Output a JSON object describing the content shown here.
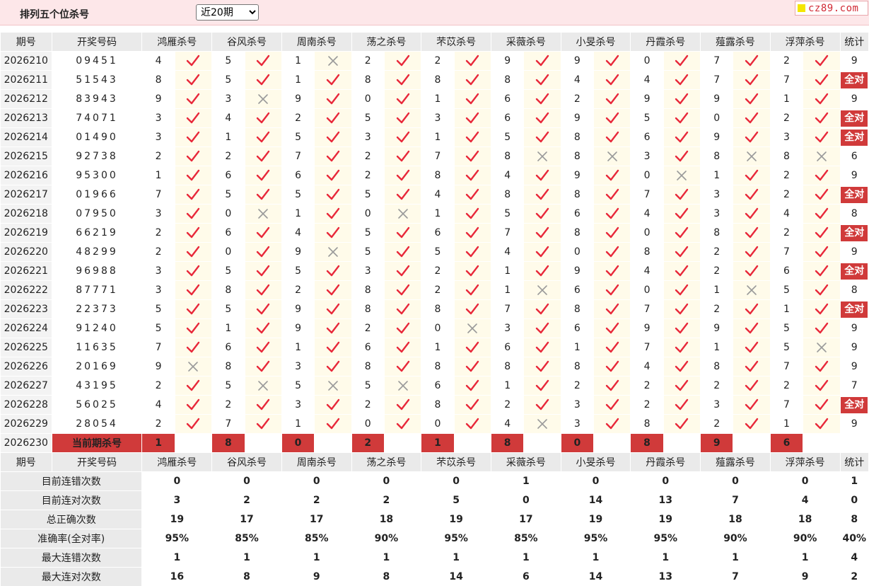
{
  "header": {
    "title": "排列五个位杀号",
    "period_select": {
      "selected": "近20期",
      "options": [
        "近20期"
      ]
    },
    "brand": "cz89.com"
  },
  "columns": {
    "issue": "期号",
    "draw": "开奖号码",
    "experts": [
      "鸿雁杀号",
      "谷风杀号",
      "周南杀号",
      "荡之杀号",
      "芣苡杀号",
      "采薇杀号",
      "小旻杀号",
      "丹霞杀号",
      "薤露杀号",
      "浮萍杀号"
    ],
    "stat": "统计"
  },
  "all_right_label": "全对",
  "rows": [
    {
      "issue": "2026210",
      "draw": "09451",
      "kills": [
        4,
        5,
        1,
        2,
        2,
        9,
        9,
        0,
        7,
        2
      ],
      "ok": [
        1,
        1,
        0,
        1,
        1,
        1,
        1,
        1,
        1,
        1
      ],
      "stat": "9"
    },
    {
      "issue": "2026211",
      "draw": "51543",
      "kills": [
        8,
        5,
        1,
        8,
        8,
        8,
        4,
        4,
        7,
        7
      ],
      "ok": [
        1,
        1,
        1,
        1,
        1,
        1,
        1,
        1,
        1,
        1
      ],
      "stat": "全对"
    },
    {
      "issue": "2026212",
      "draw": "83943",
      "kills": [
        9,
        3,
        9,
        0,
        1,
        6,
        2,
        9,
        9,
        1
      ],
      "ok": [
        1,
        0,
        1,
        1,
        1,
        1,
        1,
        1,
        1,
        1
      ],
      "stat": "9"
    },
    {
      "issue": "2026213",
      "draw": "74071",
      "kills": [
        3,
        4,
        2,
        5,
        3,
        6,
        9,
        5,
        0,
        2
      ],
      "ok": [
        1,
        1,
        1,
        1,
        1,
        1,
        1,
        1,
        1,
        1
      ],
      "stat": "全对"
    },
    {
      "issue": "2026214",
      "draw": "01490",
      "kills": [
        3,
        1,
        5,
        3,
        1,
        5,
        8,
        6,
        9,
        3
      ],
      "ok": [
        1,
        1,
        1,
        1,
        1,
        1,
        1,
        1,
        1,
        1
      ],
      "stat": "全对"
    },
    {
      "issue": "2026215",
      "draw": "92738",
      "kills": [
        2,
        2,
        7,
        2,
        7,
        8,
        8,
        3,
        8,
        8
      ],
      "ok": [
        1,
        1,
        1,
        1,
        1,
        0,
        0,
        1,
        0,
        0
      ],
      "stat": "6"
    },
    {
      "issue": "2026216",
      "draw": "95300",
      "kills": [
        1,
        6,
        6,
        2,
        8,
        4,
        9,
        0,
        1,
        2
      ],
      "ok": [
        1,
        1,
        1,
        1,
        1,
        1,
        1,
        0,
        1,
        1
      ],
      "stat": "9"
    },
    {
      "issue": "2026217",
      "draw": "01966",
      "kills": [
        7,
        5,
        5,
        5,
        4,
        8,
        8,
        7,
        3,
        2
      ],
      "ok": [
        1,
        1,
        1,
        1,
        1,
        1,
        1,
        1,
        1,
        1
      ],
      "stat": "全对"
    },
    {
      "issue": "2026218",
      "draw": "07950",
      "kills": [
        3,
        0,
        1,
        0,
        1,
        5,
        6,
        4,
        3,
        4
      ],
      "ok": [
        1,
        0,
        1,
        0,
        1,
        1,
        1,
        1,
        1,
        1
      ],
      "stat": "8"
    },
    {
      "issue": "2026219",
      "draw": "66219",
      "kills": [
        2,
        6,
        4,
        5,
        6,
        7,
        8,
        0,
        8,
        2
      ],
      "ok": [
        1,
        1,
        1,
        1,
        1,
        1,
        1,
        1,
        1,
        1
      ],
      "stat": "全对"
    },
    {
      "issue": "2026220",
      "draw": "48299",
      "kills": [
        2,
        0,
        9,
        5,
        5,
        4,
        0,
        8,
        2,
        7
      ],
      "ok": [
        1,
        1,
        0,
        1,
        1,
        1,
        1,
        1,
        1,
        1
      ],
      "stat": "9"
    },
    {
      "issue": "2026221",
      "draw": "96988",
      "kills": [
        3,
        5,
        5,
        3,
        2,
        1,
        9,
        4,
        2,
        6
      ],
      "ok": [
        1,
        1,
        1,
        1,
        1,
        1,
        1,
        1,
        1,
        1
      ],
      "stat": "全对"
    },
    {
      "issue": "2026222",
      "draw": "87771",
      "kills": [
        3,
        8,
        2,
        8,
        2,
        1,
        6,
        0,
        1,
        5
      ],
      "ok": [
        1,
        1,
        1,
        1,
        1,
        0,
        1,
        1,
        0,
        1
      ],
      "stat": "8"
    },
    {
      "issue": "2026223",
      "draw": "22373",
      "kills": [
        5,
        5,
        9,
        8,
        8,
        7,
        8,
        7,
        2,
        1
      ],
      "ok": [
        1,
        1,
        1,
        1,
        1,
        1,
        1,
        1,
        1,
        1
      ],
      "stat": "全对"
    },
    {
      "issue": "2026224",
      "draw": "91240",
      "kills": [
        5,
        1,
        9,
        2,
        0,
        3,
        6,
        9,
        9,
        5
      ],
      "ok": [
        1,
        1,
        1,
        1,
        0,
        1,
        1,
        1,
        1,
        1
      ],
      "stat": "9"
    },
    {
      "issue": "2026225",
      "draw": "11635",
      "kills": [
        7,
        6,
        1,
        6,
        1,
        6,
        1,
        7,
        1,
        5
      ],
      "ok": [
        1,
        1,
        1,
        1,
        1,
        1,
        1,
        1,
        1,
        0
      ],
      "stat": "9"
    },
    {
      "issue": "2026226",
      "draw": "20169",
      "kills": [
        9,
        8,
        3,
        8,
        8,
        8,
        8,
        4,
        8,
        7
      ],
      "ok": [
        0,
        1,
        1,
        1,
        1,
        1,
        1,
        1,
        1,
        1
      ],
      "stat": "9"
    },
    {
      "issue": "2026227",
      "draw": "43195",
      "kills": [
        2,
        5,
        5,
        5,
        6,
        1,
        2,
        2,
        2,
        2
      ],
      "ok": [
        1,
        0,
        0,
        0,
        1,
        1,
        1,
        1,
        1,
        1
      ],
      "stat": "7"
    },
    {
      "issue": "2026228",
      "draw": "56025",
      "kills": [
        4,
        2,
        3,
        2,
        8,
        2,
        3,
        2,
        3,
        7
      ],
      "ok": [
        1,
        1,
        1,
        1,
        1,
        1,
        1,
        1,
        1,
        1
      ],
      "stat": "全对"
    },
    {
      "issue": "2026229",
      "draw": "28054",
      "kills": [
        2,
        7,
        1,
        0,
        0,
        4,
        3,
        8,
        2,
        1
      ],
      "ok": [
        1,
        1,
        1,
        1,
        1,
        0,
        1,
        1,
        1,
        1
      ],
      "stat": "9"
    }
  ],
  "current": {
    "issue": "2026230",
    "label": "当前期杀号",
    "kills": [
      1,
      8,
      0,
      2,
      1,
      8,
      0,
      8,
      9,
      6
    ]
  },
  "stats": [
    {
      "label": "目前连错次数",
      "values": [
        "0",
        "0",
        "0",
        "0",
        "0",
        "1",
        "0",
        "0",
        "0",
        "0"
      ],
      "total": "1"
    },
    {
      "label": "目前连对次数",
      "values": [
        "3",
        "2",
        "2",
        "2",
        "5",
        "0",
        "14",
        "13",
        "7",
        "4"
      ],
      "total": "0"
    },
    {
      "label": "总正确次数",
      "values": [
        "19",
        "17",
        "17",
        "18",
        "19",
        "17",
        "19",
        "19",
        "18",
        "18"
      ],
      "total": "8"
    },
    {
      "label": "准确率(全对率)",
      "values": [
        "95%",
        "85%",
        "85%",
        "90%",
        "95%",
        "85%",
        "95%",
        "95%",
        "90%",
        "90%"
      ],
      "total": "40%"
    },
    {
      "label": "最大连错次数",
      "values": [
        "1",
        "1",
        "1",
        "1",
        "1",
        "1",
        "1",
        "1",
        "1",
        "1"
      ],
      "total": "4"
    },
    {
      "label": "最大连对次数",
      "values": [
        "16",
        "8",
        "9",
        "8",
        "14",
        "6",
        "14",
        "13",
        "7",
        "9"
      ],
      "total": "2"
    }
  ],
  "colors": {
    "check": "#e8283a",
    "cross": "#9a9a9a",
    "accent": "#d03a3a",
    "stat_blue": "#1c23c9"
  }
}
